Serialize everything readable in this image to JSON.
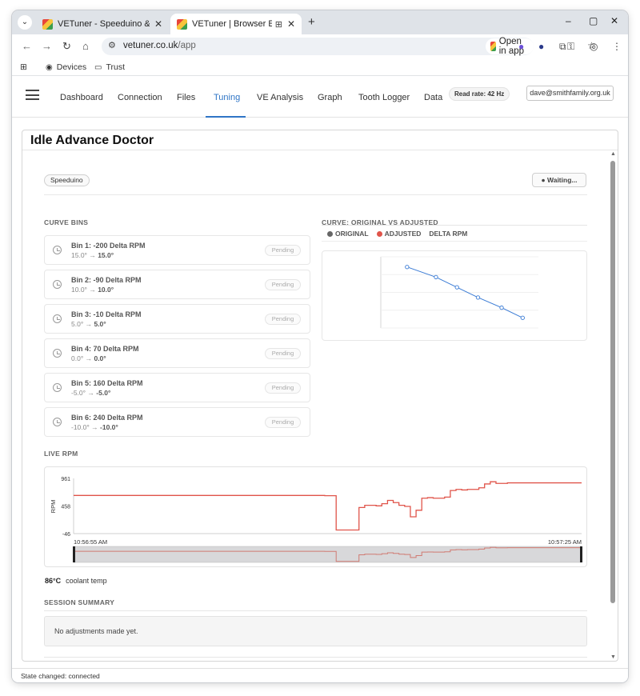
{
  "browser": {
    "tabs": [
      {
        "title": "VETuner - Speeduino & Me"
      },
      {
        "title": "VETuner | Browser ECU"
      }
    ],
    "url_host": "vetuner.co.uk",
    "url_path": "/app",
    "open_in_app": "Open in app",
    "bookmarks": [
      "Devices",
      "Trust"
    ]
  },
  "app": {
    "nav_items": [
      "Dashboard",
      "Connection",
      "Files",
      "Tuning",
      "VE Analysis",
      "Graph",
      "Tooth Logger",
      "Data"
    ],
    "active_nav": "Tuning",
    "read_rate": "Read rate: 42 Hz",
    "user": "dave@smithfamily.org.uk"
  },
  "panel": {
    "title": "Idle Advance Doctor",
    "ecu_badge": "Speeduino",
    "status": "Waiting...",
    "bins_heading": "CURVE BINS",
    "curve_heading": "CURVE: ORIGINAL VS ADJUSTED",
    "legend": [
      "ORIGINAL",
      "ADJUSTED",
      "DELTA RPM"
    ],
    "bins": [
      {
        "title": "Bin 1: -200 Delta RPM",
        "original": "15.0°",
        "arrow": "→",
        "adjusted": "15.0°",
        "status": "Pending"
      },
      {
        "title": "Bin 2: -90 Delta RPM",
        "original": "10.0°",
        "arrow": "→",
        "adjusted": "10.0°",
        "status": "Pending"
      },
      {
        "title": "Bin 3: -10 Delta RPM",
        "original": "5.0°",
        "arrow": "→",
        "adjusted": "5.0°",
        "status": "Pending"
      },
      {
        "title": "Bin 4: 70 Delta RPM",
        "original": "0.0°",
        "arrow": "→",
        "adjusted": "0.0°",
        "status": "Pending"
      },
      {
        "title": "Bin 5: 160 Delta RPM",
        "original": "-5.0°",
        "arrow": "→",
        "adjusted": "-5.0°",
        "status": "Pending"
      },
      {
        "title": "Bin 6: 240 Delta RPM",
        "original": "-10.0°",
        "arrow": "→",
        "adjusted": "-10.0°",
        "status": "Pending"
      }
    ],
    "live_heading": "LIVE RPM",
    "live_yaxis": "RPM",
    "live_yticks": [
      "961",
      "458",
      "-46"
    ],
    "live_time_start": "10:56:55 AM",
    "live_time_end": "10:57:25 AM",
    "coolant_value": "86°C",
    "coolant_label": "coolant temp",
    "summary_heading": "SESSION SUMMARY",
    "summary_text": "No adjustments made yet.",
    "statusbar": "State changed: connected"
  },
  "colors": {
    "accent": "#2f75c6",
    "curve_line": "#3a7bd5",
    "rpm_line": "#e0544a",
    "original_dot": "#666666",
    "adjusted_dot": "#e0544a"
  },
  "chart_data": [
    {
      "type": "line",
      "series": [
        {
          "x": [
            -200,
            -90,
            -10,
            70,
            160,
            240
          ],
          "values": [
            15.0,
            10.0,
            5.0,
            0.0,
            -5.0,
            -10.0
          ]
        }
      ],
      "xlim": [
        -300,
        300
      ],
      "ylim": [
        -15,
        20
      ]
    },
    {
      "type": "line",
      "series": [
        {
          "name": "RPM",
          "values": [
            650,
            650,
            650,
            650,
            650,
            650,
            650,
            650,
            650,
            650,
            650,
            650,
            650,
            650,
            650,
            650,
            650,
            650,
            650,
            650,
            650,
            650,
            650,
            650,
            650,
            650,
            650,
            650,
            650,
            650,
            650,
            650,
            650,
            650,
            650,
            650,
            650,
            650,
            650,
            650,
            650,
            650,
            650,
            650,
            645,
            645,
            20,
            20,
            20,
            20,
            430,
            470,
            470,
            460,
            500,
            560,
            520,
            470,
            450,
            260,
            380,
            600,
            610,
            600,
            600,
            620,
            740,
            760,
            750,
            760,
            760,
            790,
            860,
            900,
            870,
            870,
            880,
            880,
            880,
            880,
            880,
            880,
            880,
            880,
            880,
            880,
            880,
            880,
            880,
            880
          ]
        }
      ],
      "ylim": [
        -46,
        961
      ]
    }
  ]
}
